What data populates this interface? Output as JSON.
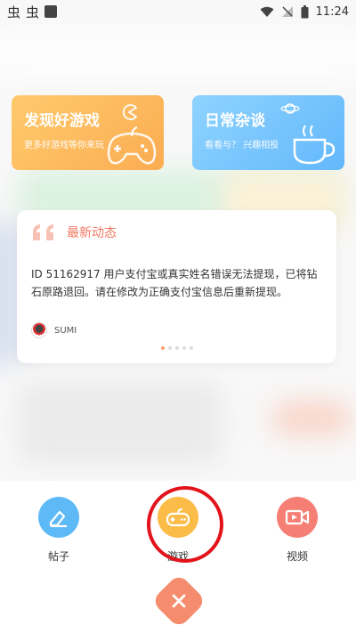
{
  "status_bar": {
    "left_icons": [
      "bug-icon",
      "bug-icon",
      "notification-square-icon"
    ],
    "left_glyphs": [
      "虫",
      "虫"
    ],
    "time": "11:24"
  },
  "cards": {
    "games": {
      "title": "发现好游戏",
      "subtitle": "更多好游戏等你来玩",
      "icon": "gamepad-icon"
    },
    "chat": {
      "title": "日常杂谈",
      "subtitle": "看看与？ 兴趣相投",
      "icon": "coffee-cup-icon"
    }
  },
  "news": {
    "title": "最新动态",
    "body": "ID 51162917 用户支付宝或真实姓名错误无法提现，已将钻石原路退回。请在修改为正确支付宝信息后重新提现。",
    "username": "SUMI",
    "pager_total": 5,
    "pager_active": 1
  },
  "actions": [
    {
      "label": "帖子",
      "icon": "edit-post-icon"
    },
    {
      "label": "游戏",
      "icon": "gamepad-icon"
    },
    {
      "label": "视频",
      "icon": "video-camera-icon"
    }
  ],
  "colors": {
    "games_card": "#fbac52",
    "chat_card": "#62b8fb",
    "news_title": "#f07863",
    "post_button": "#5eb9f7",
    "game_button": "#fbbc48",
    "video_button": "#f57f74",
    "close_button": "#f58c6d",
    "highlight_ring": "#e3131b"
  }
}
